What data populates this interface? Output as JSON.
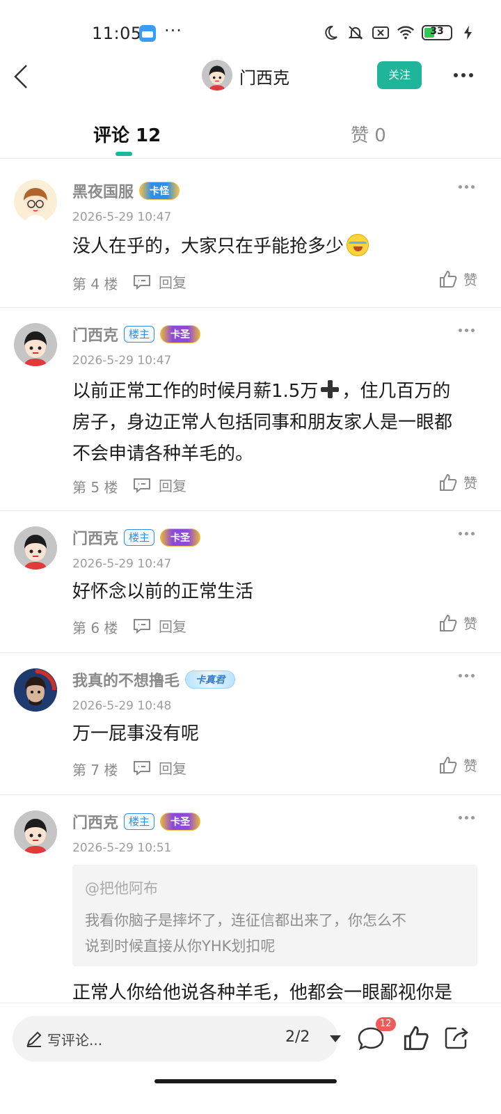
{
  "status_bar": {
    "time": "11:05",
    "dots": "···",
    "battery_level": "33",
    "battery_color": "#36c557"
  },
  "header": {
    "user_name": "门西克",
    "follow_label": "关注",
    "accent_color": "#1fb59b"
  },
  "tabs": {
    "comments_label": "评论 12",
    "likes_label": "赞 0"
  },
  "comments": [
    {
      "user": "黑夜国服",
      "rank_badge": "卡怪",
      "time": "2026-5-29 10:47",
      "text": "没人在乎的，大家只在乎能抢多少",
      "floor": "第 4 楼",
      "reply_label": "回复",
      "like_label": "赞"
    },
    {
      "user": "门西克",
      "op_badge": "楼主",
      "rank_badge": "卡圣",
      "time": "2026-5-29 10:47",
      "text_lines": [
        "以前正常工作的时候月薪1.5万",
        "，住几百万的",
        "房子，身边正常人包括同事和朋友家人是一眼都",
        "不会申请各种羊毛的。"
      ],
      "floor": "第 5 楼",
      "reply_label": "回复",
      "like_label": "赞"
    },
    {
      "user": "门西克",
      "op_badge": "楼主",
      "rank_badge": "卡圣",
      "time": "2026-5-29 10:47",
      "text": "好怀念以前的正常生活",
      "floor": "第 6 楼",
      "reply_label": "回复",
      "like_label": "赞"
    },
    {
      "user": "我真的不想撸毛",
      "rank_badge": "卡真君",
      "time": "2026-5-29 10:48",
      "text": "万一屁事没有呢",
      "floor": "第 7 楼",
      "reply_label": "回复",
      "like_label": "赞"
    },
    {
      "user": "门西克",
      "op_badge": "楼主",
      "rank_badge": "卡圣",
      "time": "2026-5-29 10:51",
      "quote_user": "@把他阿布",
      "quote_lines": [
        "我看你脑子是摔坏了，连征信都出来了，你怎么不",
        "说到时候直接从你YHK划扣呢"
      ],
      "text": "正常人你给他说各种羊毛，他都会一眼鄙视你是"
    }
  ],
  "bottom_bar": {
    "input_placeholder": "写评论...",
    "page_indicator": "2/2",
    "comment_count": "12"
  }
}
